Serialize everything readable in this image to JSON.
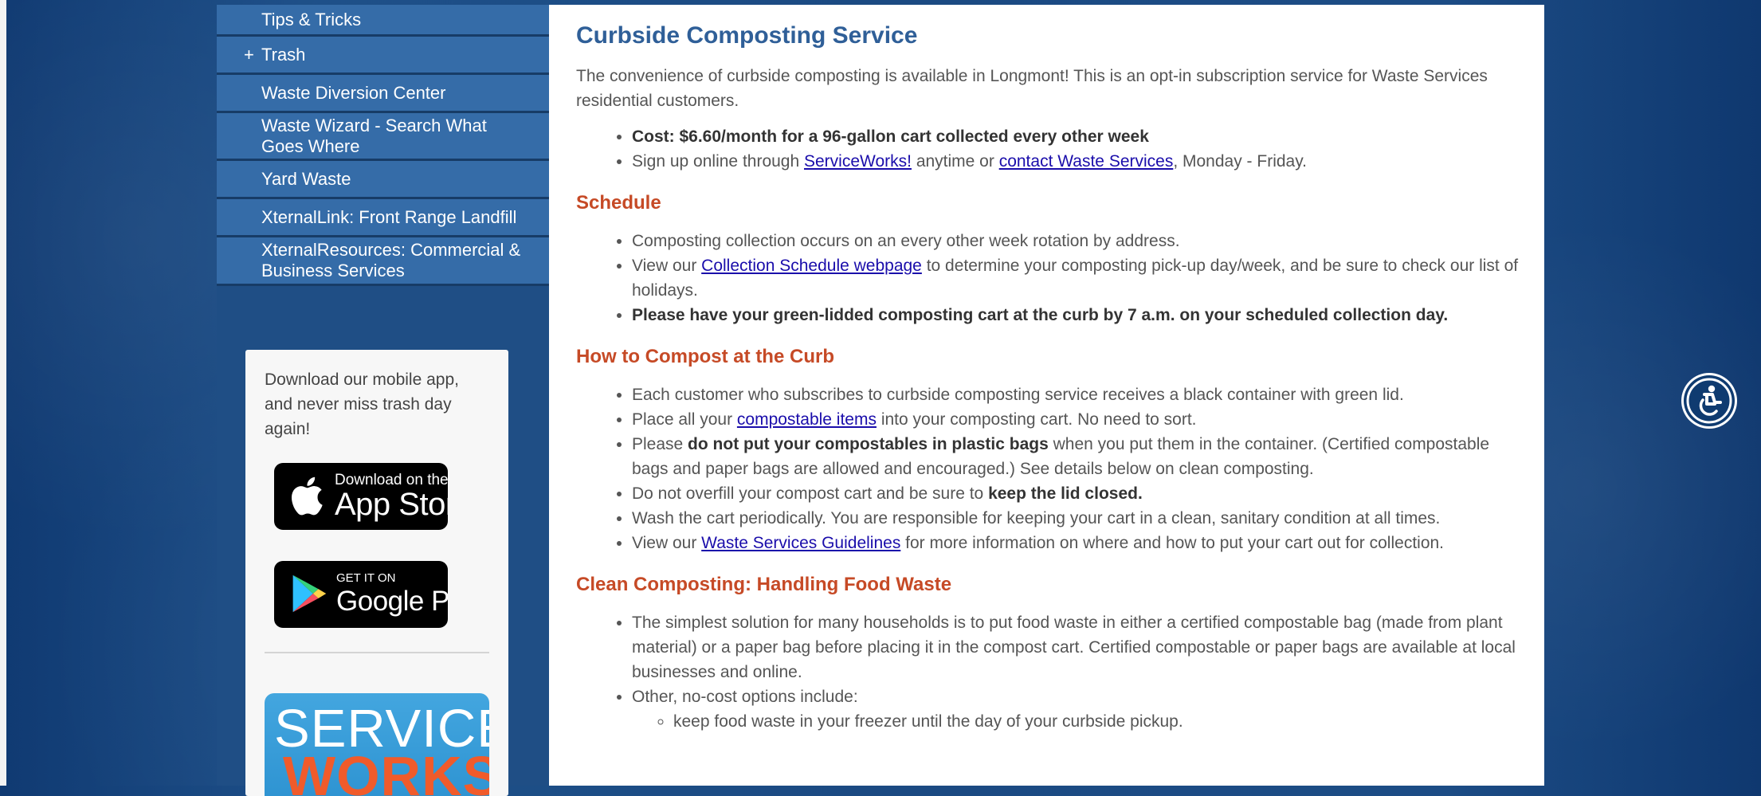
{
  "sidebar": {
    "items": [
      {
        "label": "Tips & Tricks",
        "prefix": ""
      },
      {
        "label": "Trash",
        "prefix": "+"
      },
      {
        "label": "Waste Diversion Center",
        "prefix": ""
      },
      {
        "label": "Waste Wizard - Search What Goes Where",
        "prefix": ""
      },
      {
        "label": "Yard Waste",
        "prefix": ""
      },
      {
        "label": "XternalLink: Front Range Landfill",
        "prefix": ""
      },
      {
        "label": "XternalResources: Commercial & Business Services",
        "prefix": ""
      }
    ]
  },
  "app_promo": {
    "text": "Download our mobile app, and never miss trash day again!",
    "app_store": {
      "line1": "Download on the",
      "line2": "App Store"
    },
    "google_play": {
      "line1": "GET IT ON",
      "line2": "Google Play"
    },
    "serviceworks": {
      "line1": "SERVICE",
      "line2": "WORKS!"
    }
  },
  "main": {
    "title": "Curbside Composting Service",
    "intro": "The convenience of curbside composting is available in Longmont! This is an opt-in subscription service for Waste Services residential customers.",
    "cost_bold": "Cost: $6.60/month for a 96-gallon cart collected every other week",
    "signup": {
      "prefix": "Sign up online through ",
      "link1": "ServiceWorks!",
      "middle": " anytime or ",
      "link2": "contact Waste Services",
      "suffix": ", Monday - Friday."
    },
    "schedule": {
      "heading": "Schedule",
      "item1": "Composting collection occurs on an every other week rotation by address.",
      "item2_prefix": "View our ",
      "item2_link": "Collection Schedule webpage",
      "item2_suffix": " to determine your composting pick-up day/week, and be sure to check our list of holidays.",
      "item3_bold": "Please have your green-lidded composting cart at the curb by 7 a.m. on your scheduled collection day."
    },
    "how": {
      "heading": "How to Compost at the Curb",
      "item1": "Each customer who subscribes to curbside composting service receives a black container with green lid.",
      "item2_prefix": "Place all your ",
      "item2_link": "compostable items",
      "item2_suffix": " into your composting cart. No need to sort.",
      "item3_prefix": "Please ",
      "item3_bold": "do not put your compostables in plastic bags",
      "item3_suffix": " when you put them in the container. (Certified compostable bags and paper bags are allowed and encouraged.) See details below on clean composting.",
      "item4_prefix": "Do not overfill your compost cart and be sure to ",
      "item4_bold": "keep the lid closed.",
      "item5": "Wash the cart periodically. You are responsible for keeping your cart in a clean, sanitary condition at all times.",
      "item6_prefix": "View our ",
      "item6_link": "Waste Services Guidelines",
      "item6_suffix": " for more information on where and how to put your cart out for collection."
    },
    "clean": {
      "heading": "Clean Composting: Handling Food Waste",
      "item1": "The simplest solution for many households is to put food waste in either a certified compostable bag (made from plant material) or a paper bag before placing it in the compost cart. Certified compostable or paper bags are available at local businesses and online.",
      "item2": "Other, no-cost options include:",
      "sub1": "keep food waste in your freezer until the day of your curbside pickup."
    }
  },
  "icons": {
    "accessibility": "accessibility-icon",
    "apple": "apple-logo-icon",
    "google_play": "google-play-icon"
  },
  "colors": {
    "heading_blue": "#2f5f98",
    "heading_orange": "#c64a26",
    "link": "#1a0dab",
    "sidebar_item": "#356ca8",
    "sidebar_bg": "#1f4e85"
  }
}
